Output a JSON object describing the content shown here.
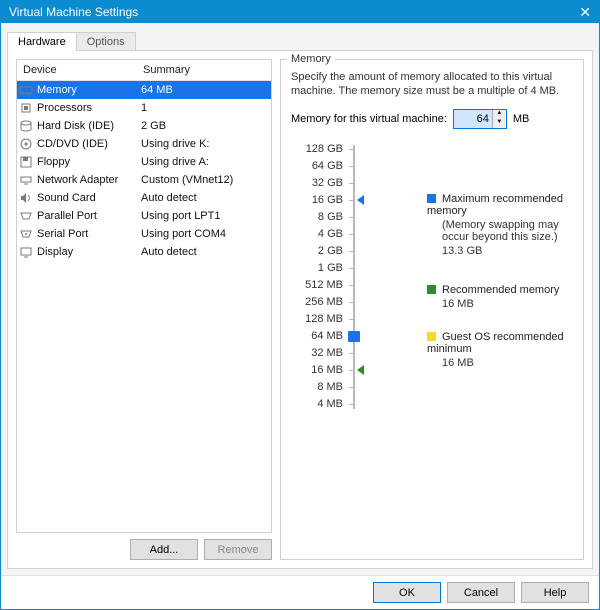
{
  "titlebar": {
    "title": "Virtual Machine Settings",
    "close": "✕"
  },
  "tabs": {
    "hardware": "Hardware",
    "options": "Options"
  },
  "left": {
    "hdr_device": "Device",
    "hdr_summary": "Summary",
    "rows": [
      {
        "name": "Memory",
        "summary": "64 MB",
        "icon": "memory-icon",
        "selected": true
      },
      {
        "name": "Processors",
        "summary": "1",
        "icon": "cpu-icon",
        "selected": false
      },
      {
        "name": "Hard Disk (IDE)",
        "summary": "2 GB",
        "icon": "hdd-icon",
        "selected": false
      },
      {
        "name": "CD/DVD (IDE)",
        "summary": "Using drive K:",
        "icon": "cd-icon",
        "selected": false
      },
      {
        "name": "Floppy",
        "summary": "Using drive A:",
        "icon": "floppy-icon",
        "selected": false
      },
      {
        "name": "Network Adapter",
        "summary": "Custom (VMnet12)",
        "icon": "network-icon",
        "selected": false
      },
      {
        "name": "Sound Card",
        "summary": "Auto detect",
        "icon": "sound-icon",
        "selected": false
      },
      {
        "name": "Parallel Port",
        "summary": "Using port LPT1",
        "icon": "parallel-icon",
        "selected": false
      },
      {
        "name": "Serial Port",
        "summary": "Using port COM4",
        "icon": "serial-icon",
        "selected": false
      },
      {
        "name": "Display",
        "summary": "Auto detect",
        "icon": "display-icon",
        "selected": false
      }
    ],
    "add": "Add...",
    "remove": "Remove"
  },
  "memory": {
    "legend": "Memory",
    "desc": "Specify the amount of memory allocated to this virtual machine. The memory size must be a multiple of 4 MB.",
    "field_label": "Memory for this virtual machine:",
    "value": "64",
    "unit": "MB",
    "scale": [
      "128 GB",
      "64 GB",
      "32 GB",
      "16 GB",
      "8 GB",
      "4 GB",
      "2 GB",
      "1 GB",
      "512 MB",
      "256 MB",
      "128 MB",
      "64 MB",
      "32 MB",
      "16 MB",
      "8 MB",
      "4 MB"
    ],
    "markers": {
      "max": {
        "title": "Maximum recommended memory",
        "note": "(Memory swapping may occur beyond this size.)",
        "value": "13.3 GB",
        "color": "blue",
        "at": 3
      },
      "rec": {
        "title": "Recommended memory",
        "note": "",
        "value": "16 MB",
        "color": "green",
        "at": 13
      },
      "guest": {
        "title": "Guest OS recommended minimum",
        "note": "",
        "value": "16 MB",
        "color": "yellow",
        "at": 13
      }
    },
    "thumb_at": 11
  },
  "footer": {
    "ok": "OK",
    "cancel": "Cancel",
    "help": "Help"
  }
}
